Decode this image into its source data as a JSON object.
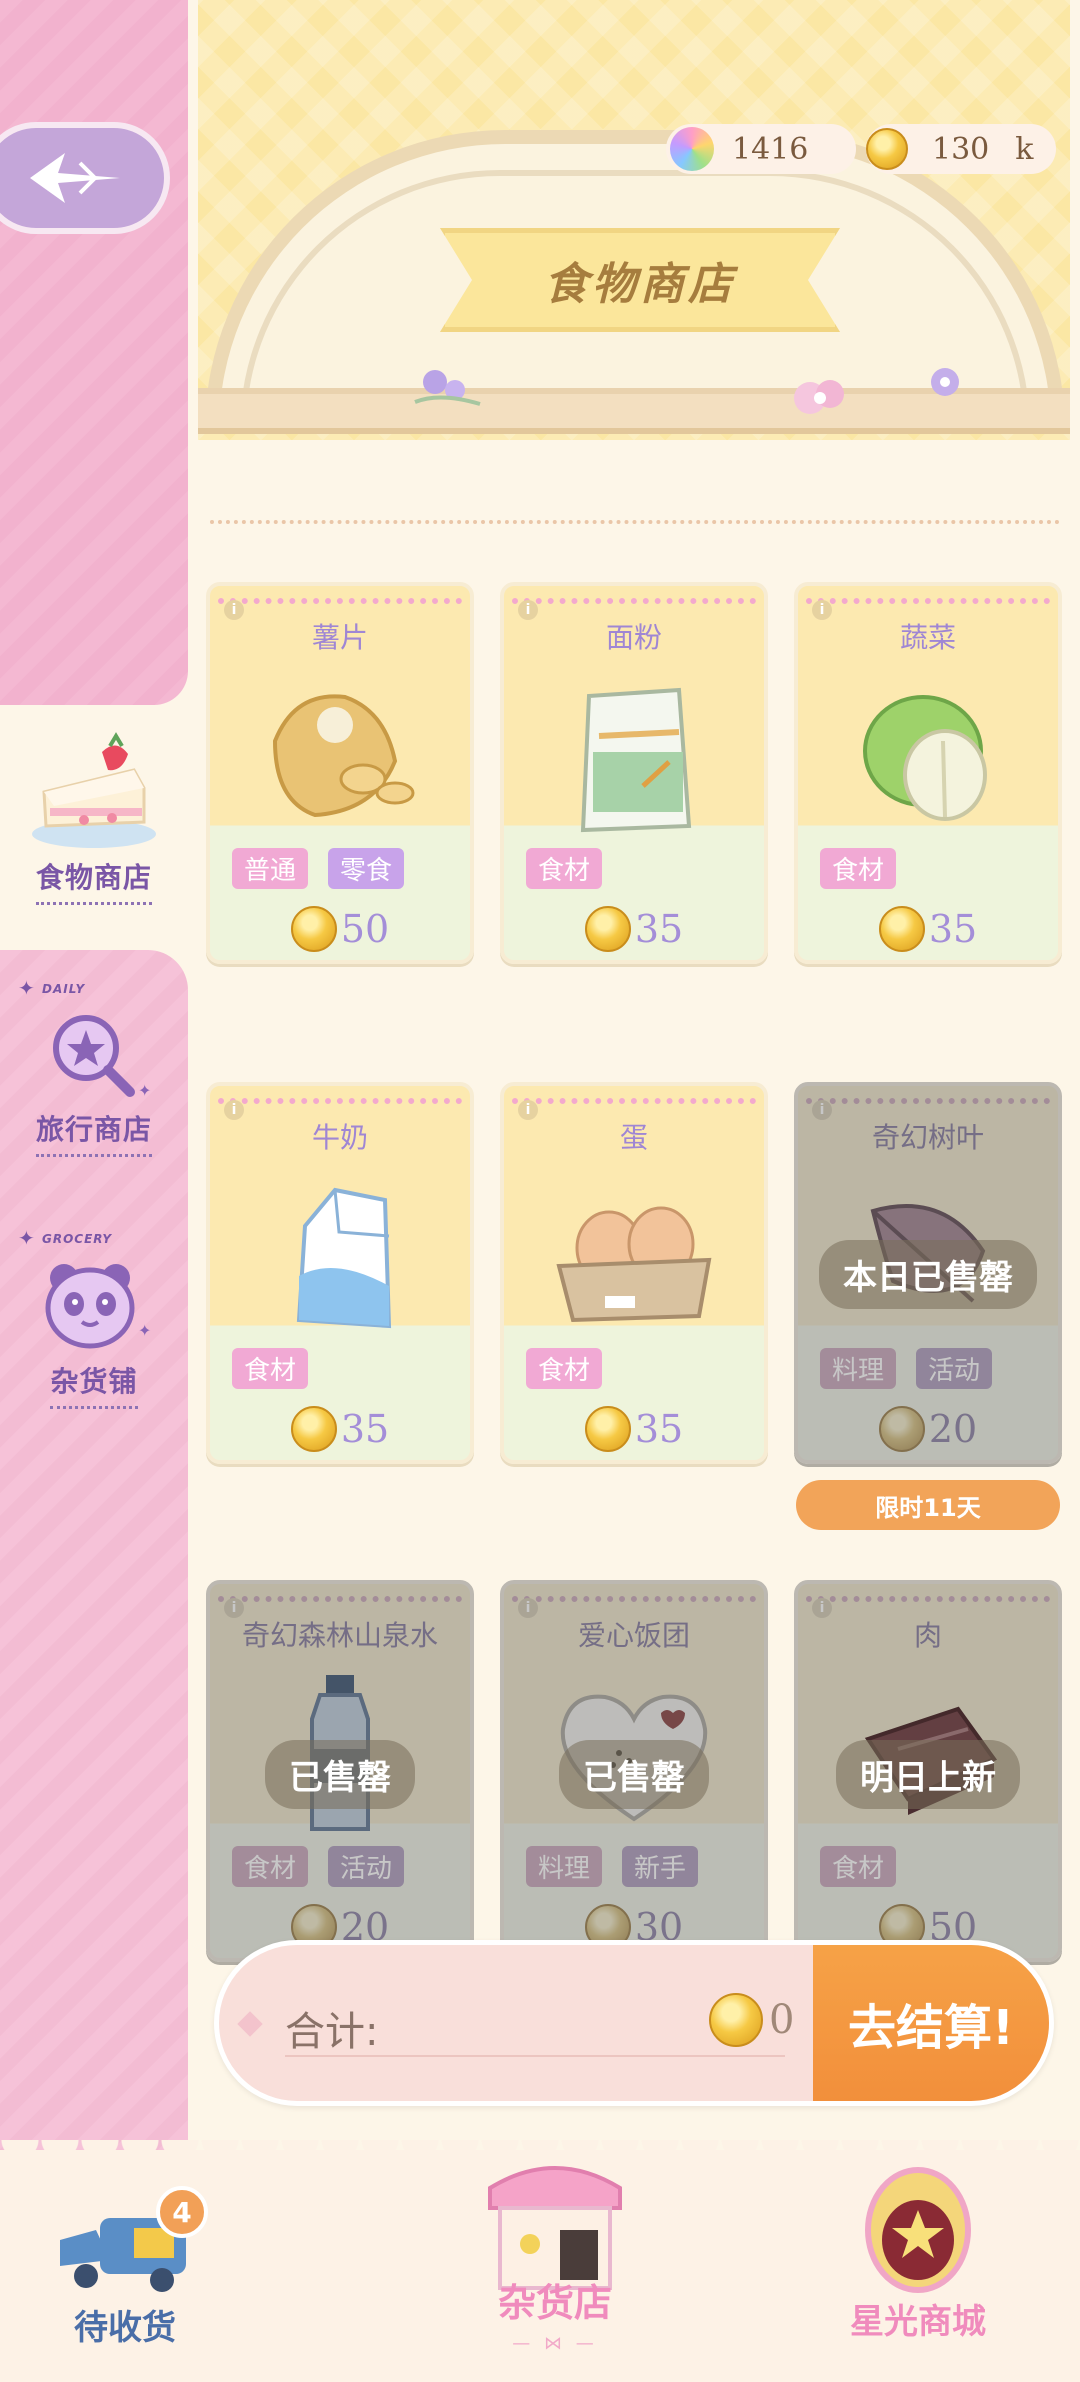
{
  "currency": {
    "stars": "1416",
    "coins": "130",
    "coins_unit": "k"
  },
  "header": {
    "title": "食物商店"
  },
  "sidebar": {
    "items": [
      {
        "label": "食物商店",
        "tag": "",
        "icon": "cake-icon"
      },
      {
        "label": "旅行商店",
        "tag": "DAILY",
        "icon": "magnifier-star-icon"
      },
      {
        "label": "杂货铺",
        "tag": "GROCERY",
        "icon": "panda-icon"
      }
    ]
  },
  "products": [
    {
      "name": "薯片",
      "tags": [
        "普通",
        "零食"
      ],
      "price": "50",
      "status": ""
    },
    {
      "name": "面粉",
      "tags": [
        "食材"
      ],
      "price": "35",
      "status": ""
    },
    {
      "name": "蔬菜",
      "tags": [
        "食材"
      ],
      "price": "35",
      "status": ""
    },
    {
      "name": "牛奶",
      "tags": [
        "食材"
      ],
      "price": "35",
      "status": ""
    },
    {
      "name": "蛋",
      "tags": [
        "食材"
      ],
      "price": "35",
      "status": ""
    },
    {
      "name": "奇幻树叶",
      "tags": [
        "料理",
        "活动"
      ],
      "price": "20",
      "status": "本日已售罄"
    },
    {
      "name": "奇幻森林山泉水",
      "tags": [
        "食材",
        "活动"
      ],
      "price": "20",
      "status": "已售罄"
    },
    {
      "name": "爱心饭团",
      "tags": [
        "料理",
        "新手"
      ],
      "price": "30",
      "status": "已售罄"
    },
    {
      "name": "肉",
      "tags": [
        "食材"
      ],
      "price": "50",
      "status": "明日上新"
    }
  ],
  "limited_badge": "限时11天",
  "checkout": {
    "total_label": "合计:",
    "total_value": "0",
    "pay_label": "去结算!"
  },
  "bottom_nav": {
    "pending": {
      "label": "待收货",
      "badge": "4"
    },
    "grocery": {
      "label": "杂货店"
    },
    "starlight": {
      "label": "星光商城"
    }
  },
  "colors": {
    "sidebar_pink": "#f4b8d2",
    "accent_purple": "#7a56a6",
    "price_purple": "#a48ed8",
    "pay_orange": "#f28f3b",
    "header_yellow": "#fbe7a4"
  }
}
